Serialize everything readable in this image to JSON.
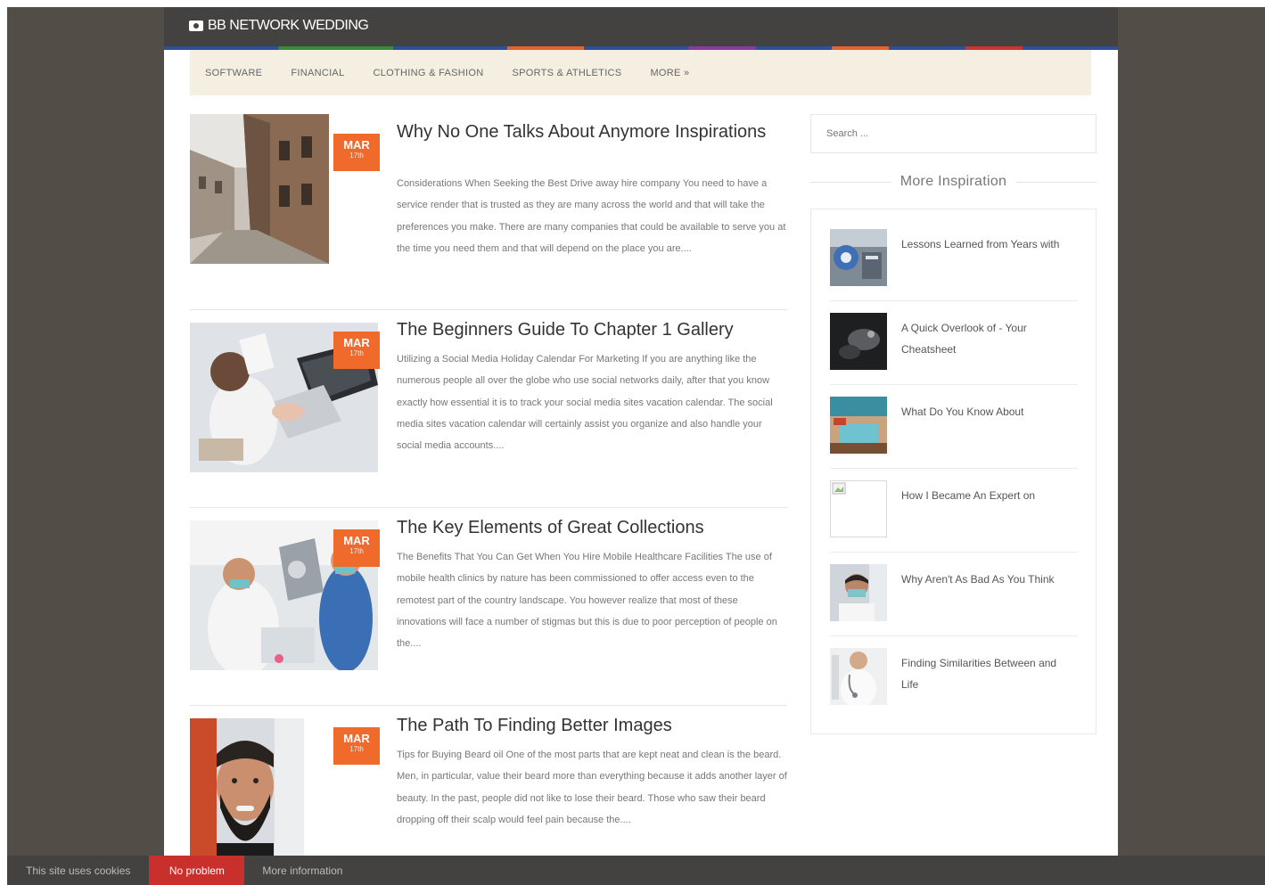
{
  "site": {
    "title": "BB NETWORK WEDDING"
  },
  "nav": [
    {
      "label": "SOFTWARE"
    },
    {
      "label": "FINANCIAL"
    },
    {
      "label": "CLOTHING & FASHION"
    },
    {
      "label": "SPORTS & ATHLETICS"
    },
    {
      "label": "MORE »"
    }
  ],
  "posts": [
    {
      "title": "Why No One Talks About Anymore Inspirations",
      "date_month": "MAR",
      "date_day": "17th",
      "excerpt": "Considerations When Seeking the Best Drive away hire company You need to have a service render that is trusted as they are many across the world and that will take the preferences you make. There are many companies that could be available to serve you at the time you need them and that will depend on the place you are....",
      "thumb_icon": "street-photo"
    },
    {
      "title": "The Beginners Guide To Chapter 1 Gallery",
      "date_month": "MAR",
      "date_day": "17th",
      "excerpt": "Utilizing a Social Media Holiday Calendar For Marketing If you are anything like the numerous people all over the globe who use social networks daily, after that you know exactly how essential it is to track your social media sites vacation calendar. The social media sites vacation calendar will certainly assist you organize and also handle your social media accounts....",
      "thumb_icon": "laptop-photo"
    },
    {
      "title": "The Key Elements of Great Collections",
      "date_month": "MAR",
      "date_day": "17th",
      "excerpt": "The Benefits That You Can Get When You Hire Mobile Healthcare Facilities The use of mobile health clinics by nature has been commissioned to offer access even to the remotest part of the country landscape. You however realize that most of these innovations will face a number of stigmas but this is due to poor perception of people on the....",
      "thumb_icon": "dental-photo"
    },
    {
      "title": "The Path To Finding Better Images",
      "date_month": "MAR",
      "date_day": "17th",
      "excerpt": "Tips for Buying Beard oil One of the most parts that are kept neat and clean is the beard. Men, in particular, value their beard more than everything because it adds another layer of beauty. In the past, people did not like to lose their beard. Those who saw their beard dropping off their scalp would feel pain because the....",
      "thumb_icon": "beard-photo"
    }
  ],
  "sidebar": {
    "search_placeholder": "Search ...",
    "widget_title": "More Inspiration",
    "items": [
      {
        "title": "Lessons Learned from Years with",
        "thumb_icon": "map-photo"
      },
      {
        "title": "A Quick Overlook of - Your Cheatsheet",
        "thumb_icon": "dark-photo"
      },
      {
        "title": "What Do You Know About",
        "thumb_icon": "pool-photo"
      },
      {
        "title": "How I Became An Expert on",
        "thumb_icon": "broken-image-icon"
      },
      {
        "title": "Why Aren't As Bad As You Think",
        "thumb_icon": "doctor-photo"
      },
      {
        "title": "Finding Similarities Between and Life",
        "thumb_icon": "nurse-photo"
      }
    ]
  },
  "cookie": {
    "text": "This site uses cookies",
    "accept_label": "No problem",
    "more_label": "More information"
  },
  "colors": {
    "topbar": "#444240",
    "nav_bg": "#f4efe1",
    "date_badge": "#f06a2c",
    "page_bg": "#524d47",
    "cookie_button": "#c9302c"
  }
}
